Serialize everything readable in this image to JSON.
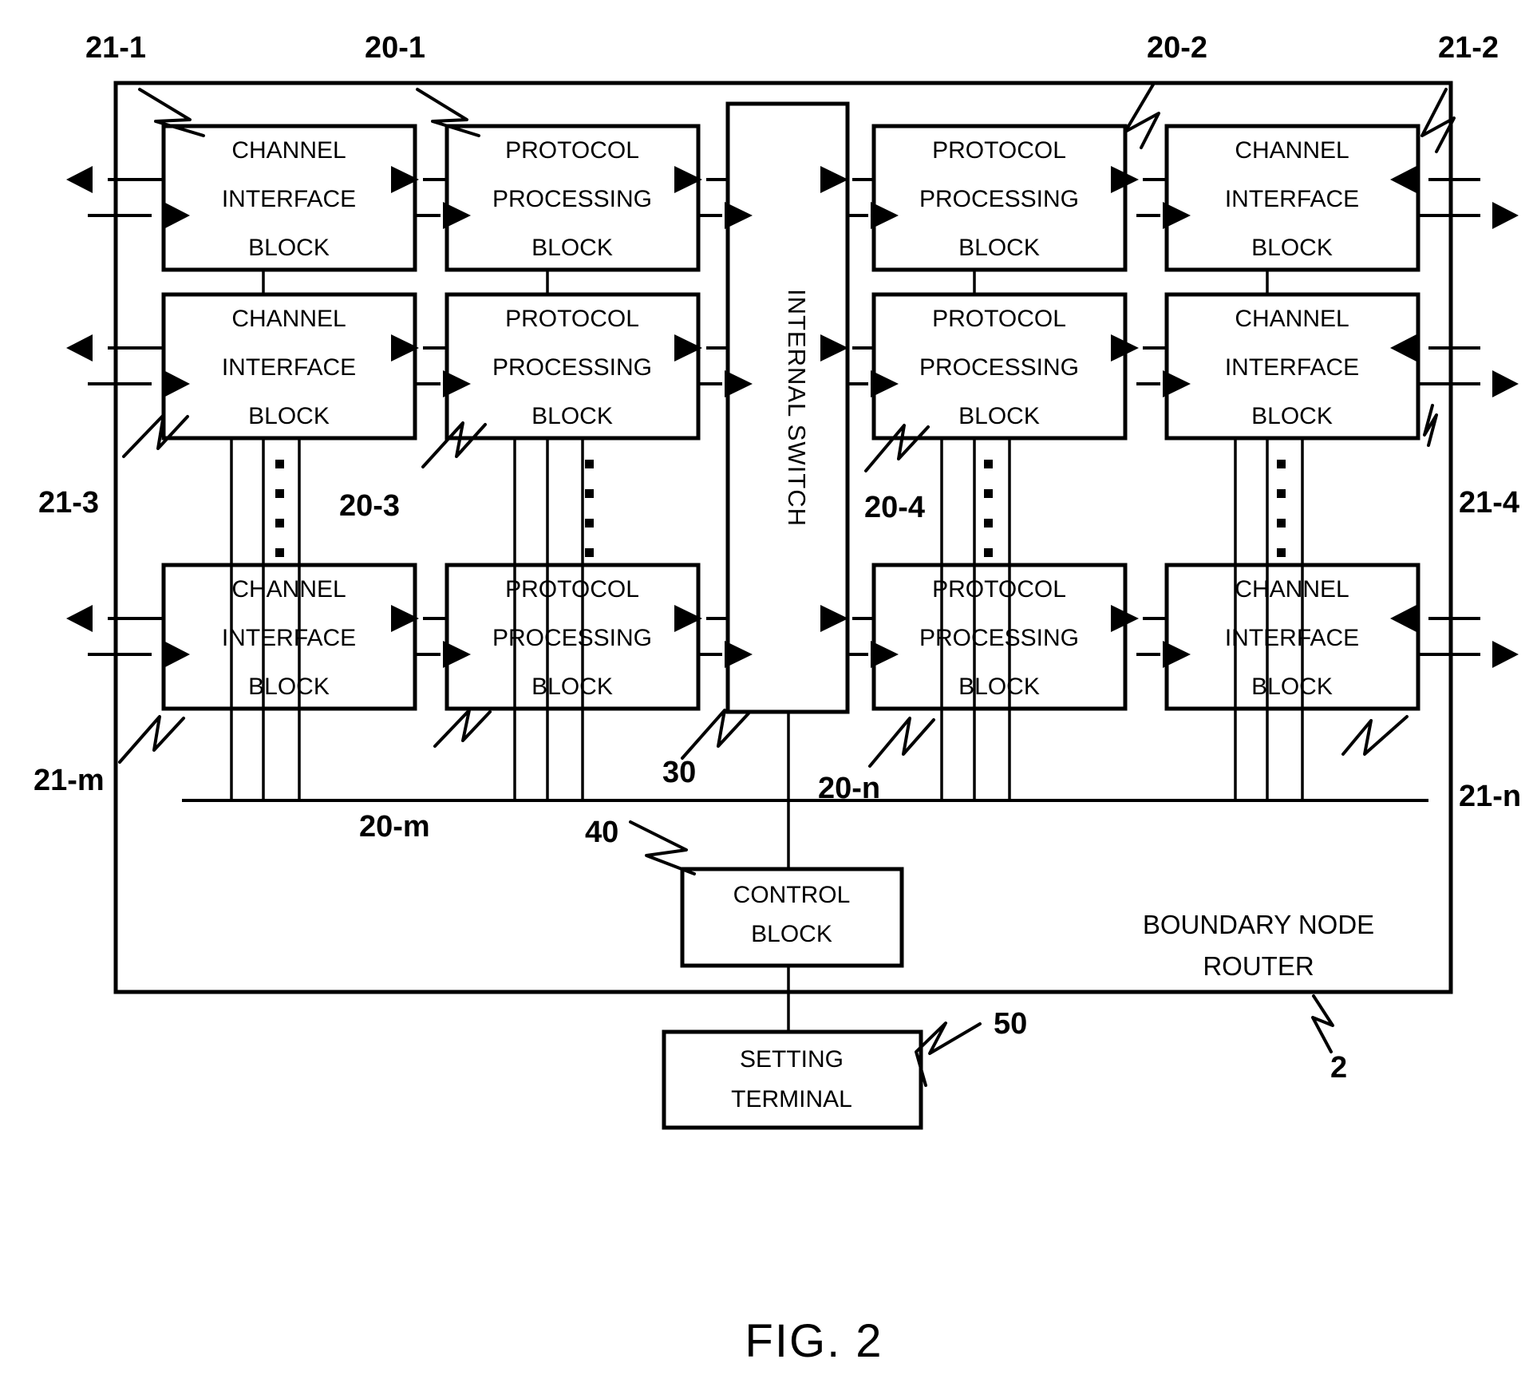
{
  "figure": {
    "caption": "FIG. 2",
    "outer_label_line1": "BOUNDARY NODE",
    "outer_label_line2": "ROUTER",
    "outer_ref": "2"
  },
  "blocks": {
    "channel_interface": {
      "l1": "CHANNEL",
      "l2": "INTERFACE",
      "l3": "BLOCK"
    },
    "protocol_processing": {
      "l1": "PROTOCOL",
      "l2": "PROCESSING",
      "l3": "BLOCK"
    },
    "internal_switch": {
      "label": "INTERNAL SWITCH"
    },
    "control_block": {
      "l1": "CONTROL",
      "l2": "BLOCK"
    },
    "setting_terminal": {
      "l1": "SETTING",
      "l2": "TERMINAL"
    }
  },
  "refs": {
    "ci_top_left": "21-1",
    "pp_top_left": "20-1",
    "pp_top_right": "20-2",
    "ci_top_right": "21-2",
    "ci_mid_left": "21-3",
    "pp_mid_left": "20-3",
    "pp_mid_right": "20-4",
    "ci_mid_right": "21-4",
    "ci_bot_left": "21-m",
    "pp_bot_left": "20-m",
    "switch": "30",
    "bus": "40",
    "pp_bot_right": "20-n",
    "ci_bot_right": "21-n",
    "setting_terminal": "50"
  },
  "columns": [
    {
      "name": "channel-interface-left",
      "kind": "channel_interface"
    },
    {
      "name": "protocol-processing-left",
      "kind": "protocol_processing"
    },
    {
      "name": "internal-switch",
      "kind": "internal_switch"
    },
    {
      "name": "protocol-processing-right",
      "kind": "protocol_processing"
    },
    {
      "name": "channel-interface-right",
      "kind": "channel_interface"
    }
  ],
  "rows": [
    "row-1",
    "row-2",
    "row-n"
  ],
  "colors": {
    "stroke": "#000000",
    "fill": "#ffffff"
  }
}
